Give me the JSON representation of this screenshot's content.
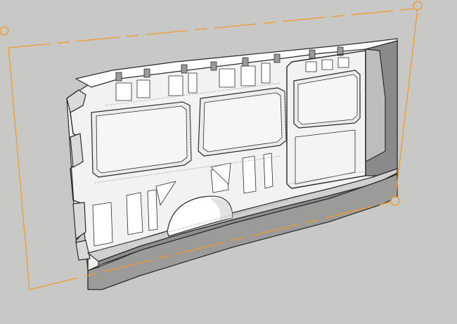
{
  "viewport": {
    "background_color": "#c8c8c6",
    "tool": "scale",
    "selected_object": "van-side-wall-panel"
  },
  "colors": {
    "selection": "#f39a2a",
    "model_face": "#ffffff",
    "model_shade": "#e4e4e2",
    "model_dark": "#7c7c7c",
    "model_edge": "#2b2b2b",
    "hidden_edge": "#8a8a8a"
  },
  "icons": {
    "grips": "scale-grip-icon"
  }
}
